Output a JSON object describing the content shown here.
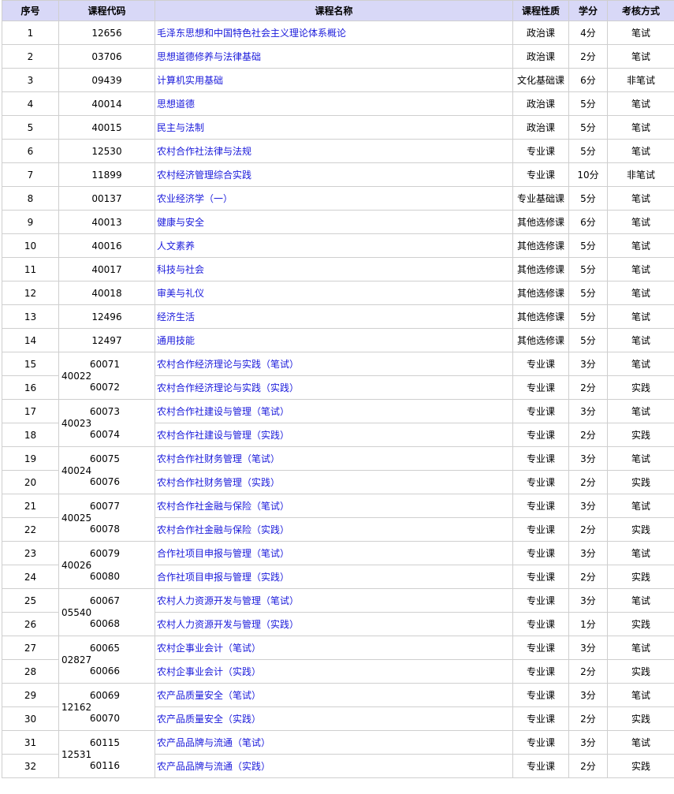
{
  "headers": [
    "序号",
    "课程代码",
    "课程名称",
    "课程性质",
    "学分",
    "考核方式"
  ],
  "rows": [
    {
      "no": "1",
      "code": "12656",
      "name": "毛泽东思想和中国特色社会主义理论体系概论",
      "type": "政治课",
      "credit": "4分",
      "exam": "笔试"
    },
    {
      "no": "2",
      "code": "03706",
      "name": "思想道德修养与法律基础",
      "type": "政治课",
      "credit": "2分",
      "exam": "笔试"
    },
    {
      "no": "3",
      "code": "09439",
      "name": "计算机实用基础",
      "type": "文化基础课",
      "credit": "6分",
      "exam": "非笔试"
    },
    {
      "no": "4",
      "code": "40014",
      "name": "思想道德",
      "type": "政治课",
      "credit": "5分",
      "exam": "笔试"
    },
    {
      "no": "5",
      "code": "40015",
      "name": "民主与法制",
      "type": "政治课",
      "credit": "5分",
      "exam": "笔试"
    },
    {
      "no": "6",
      "code": "12530",
      "name": "农村合作社法律与法规",
      "type": "专业课",
      "credit": "5分",
      "exam": "笔试"
    },
    {
      "no": "7",
      "code": "11899",
      "name": "农村经济管理综合实践",
      "type": "专业课",
      "credit": "10分",
      "exam": "非笔试"
    },
    {
      "no": "8",
      "code": "00137",
      "name": "农业经济学（一）",
      "type": "专业基础课",
      "credit": "5分",
      "exam": "笔试"
    },
    {
      "no": "9",
      "code": "40013",
      "name": "健康与安全",
      "type": "其他选修课",
      "credit": "6分",
      "exam": "笔试"
    },
    {
      "no": "10",
      "code": "40016",
      "name": "人文素养",
      "type": "其他选修课",
      "credit": "5分",
      "exam": "笔试"
    },
    {
      "no": "11",
      "code": "40017",
      "name": "科技与社会",
      "type": "其他选修课",
      "credit": "5分",
      "exam": "笔试"
    },
    {
      "no": "12",
      "code": "40018",
      "name": "审美与礼仪",
      "type": "其他选修课",
      "credit": "5分",
      "exam": "笔试"
    },
    {
      "no": "13",
      "code": "12496",
      "name": "经济生活",
      "type": "其他选修课",
      "credit": "5分",
      "exam": "笔试"
    },
    {
      "no": "14",
      "code": "12497",
      "name": "通用技能",
      "type": "其他选修课",
      "credit": "5分",
      "exam": "笔试"
    }
  ],
  "groups": [
    {
      "code": "40022",
      "items": [
        {
          "no": "15",
          "code": "60071",
          "name": "农村合作经济理论与实践（笔试）",
          "type": "专业课",
          "credit": "3分",
          "exam": "笔试"
        },
        {
          "no": "16",
          "code": "60072",
          "name": "农村合作经济理论与实践（实践）",
          "type": "专业课",
          "credit": "2分",
          "exam": "实践"
        }
      ]
    },
    {
      "code": "40023",
      "items": [
        {
          "no": "17",
          "code": "60073",
          "name": "农村合作社建设与管理（笔试）",
          "type": "专业课",
          "credit": "3分",
          "exam": "笔试"
        },
        {
          "no": "18",
          "code": "60074",
          "name": "农村合作社建设与管理（实践）",
          "type": "专业课",
          "credit": "2分",
          "exam": "实践"
        }
      ]
    },
    {
      "code": "40024",
      "items": [
        {
          "no": "19",
          "code": "60075",
          "name": "农村合作社财务管理（笔试）",
          "type": "专业课",
          "credit": "3分",
          "exam": "笔试"
        },
        {
          "no": "20",
          "code": "60076",
          "name": "农村合作社财务管理（实践）",
          "type": "专业课",
          "credit": "2分",
          "exam": "实践"
        }
      ]
    },
    {
      "code": "40025",
      "items": [
        {
          "no": "21",
          "code": "60077",
          "name": "农村合作社金融与保险（笔试）",
          "type": "专业课",
          "credit": "3分",
          "exam": "笔试"
        },
        {
          "no": "22",
          "code": "60078",
          "name": "农村合作社金融与保险（实践）",
          "type": "专业课",
          "credit": "2分",
          "exam": "实践"
        }
      ]
    },
    {
      "code": "40026",
      "items": [
        {
          "no": "23",
          "code": "60079",
          "name": "合作社项目申报与管理（笔试）",
          "type": "专业课",
          "credit": "3分",
          "exam": "笔试"
        },
        {
          "no": "24",
          "code": "60080",
          "name": "合作社项目申报与管理（实践）",
          "type": "专业课",
          "credit": "2分",
          "exam": "实践"
        }
      ]
    },
    {
      "code": "05540",
      "items": [
        {
          "no": "25",
          "code": "60067",
          "name": "农村人力资源开发与管理（笔试）",
          "type": "专业课",
          "credit": "3分",
          "exam": "笔试"
        },
        {
          "no": "26",
          "code": "60068",
          "name": "农村人力资源开发与管理（实践）",
          "type": "专业课",
          "credit": "1分",
          "exam": "实践"
        }
      ]
    },
    {
      "code": "02827",
      "items": [
        {
          "no": "27",
          "code": "60065",
          "name": "农村企事业会计（笔试）",
          "type": "专业课",
          "credit": "3分",
          "exam": "笔试"
        },
        {
          "no": "28",
          "code": "60066",
          "name": "农村企事业会计（实践）",
          "type": "专业课",
          "credit": "2分",
          "exam": "实践"
        }
      ]
    },
    {
      "code": "12162",
      "items": [
        {
          "no": "29",
          "code": "60069",
          "name": "农产品质量安全（笔试）",
          "type": "专业课",
          "credit": "3分",
          "exam": "笔试"
        },
        {
          "no": "30",
          "code": "60070",
          "name": "农产品质量安全（实践）",
          "type": "专业课",
          "credit": "2分",
          "exam": "实践"
        }
      ]
    },
    {
      "code": "12531",
      "items": [
        {
          "no": "31",
          "code": "60115",
          "name": "农产品品牌与流通（笔试）",
          "type": "专业课",
          "credit": "3分",
          "exam": "笔试"
        },
        {
          "no": "32",
          "code": "60116",
          "name": "农产品品牌与流通（实践）",
          "type": "专业课",
          "credit": "2分",
          "exam": "实践"
        }
      ]
    }
  ]
}
